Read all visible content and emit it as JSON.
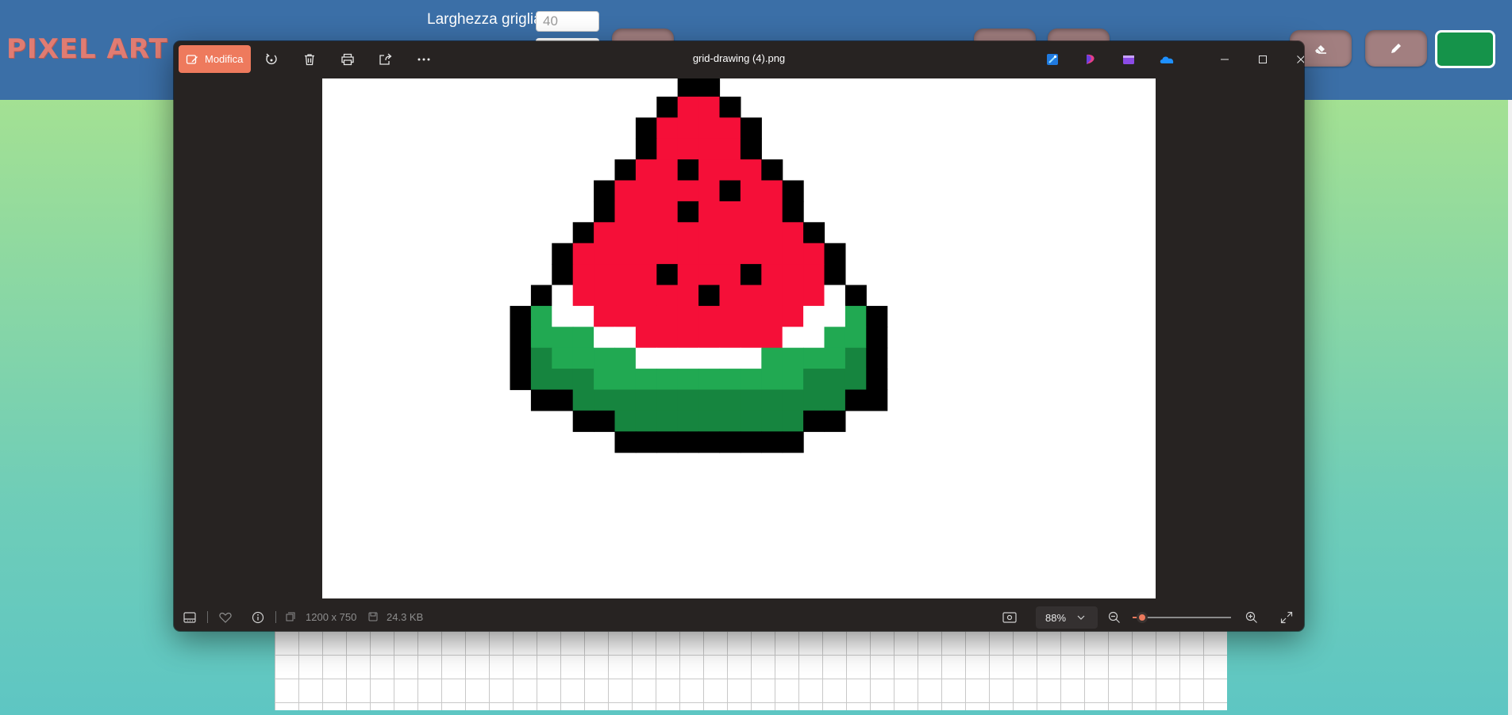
{
  "app": {
    "brand": "PIXEL ART",
    "grid_width_label": "Larghezza griglia",
    "grid_width_value": "40",
    "accent_color": "#15934a"
  },
  "viewer": {
    "edit_label": "Modifica",
    "filename": "grid-drawing (4).png",
    "toolbar_icons": [
      "rotate-icon",
      "delete-icon",
      "print-icon",
      "share-icon",
      "more-icon"
    ],
    "app_icons": [
      "designer-icon",
      "clipchamp-icon",
      "video-editor-icon",
      "onedrive-icon"
    ],
    "window_controls": [
      "minimize-icon",
      "maximize-icon",
      "close-icon"
    ],
    "dimensions": "1200 x 750",
    "file_size": "24.3 KB",
    "zoom": "88%",
    "zoom_slider_level": 0.1,
    "image_rows": [
      "........BB..........",
      ".......BRRB.........",
      "......BRRRRB........",
      "......BRRRRB........",
      ".....BRRBRRRB.......",
      "....BRRRRRBRRB......",
      "....BRRRBRRRRB......",
      "...BRRRRRRRRRRB.....",
      "..BRRRRRRRRRRRRB....",
      "..BRRRRBRRRBRRRB....",
      ".BWRRRRRRBRRRRRWB...",
      "BGWWRRRRRRRRRRWWGB..",
      "BGGGWWRRRRRRRWWGGB..",
      "BDGGGGWWWWWWGGGGDB..",
      "BDDDGGGGGGGGGGDDDB..",
      ".BBDDDDDDDDDDDDDBB..",
      "...BBDDDDDDDDDBB....",
      ".....BBBBBBBBB......"
    ],
    "palette": {
      "B": "#000000",
      "R": "#f50f38",
      "W": "#ffffff",
      "G": "#21a952",
      "D": "#16853f"
    }
  }
}
